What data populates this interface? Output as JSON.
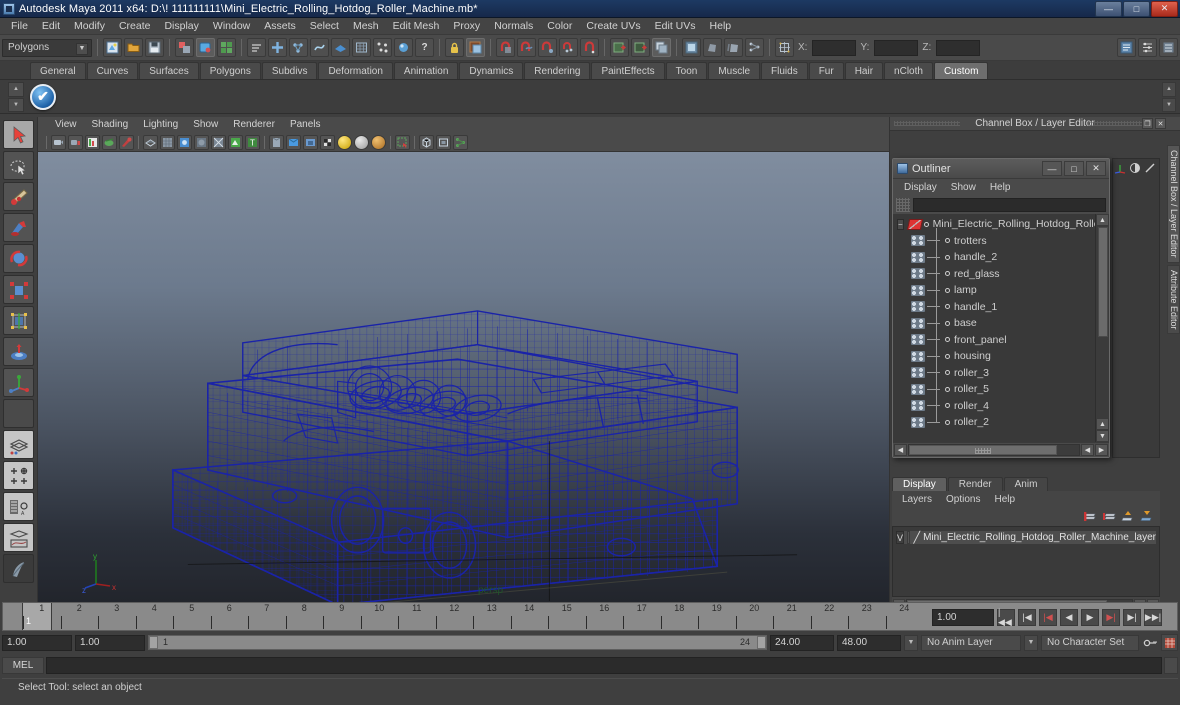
{
  "window": {
    "title": "Autodesk Maya 2011 x64: D:\\! 111111111\\Mini_Electric_Rolling_Hotdog_Roller_Machine.mb*",
    "minimize": "—",
    "maximize": "□",
    "close": "✕"
  },
  "menubar": {
    "items": [
      "File",
      "Edit",
      "Modify",
      "Create",
      "Display",
      "Window",
      "Assets",
      "Select",
      "Mesh",
      "Edit Mesh",
      "Proxy",
      "Normals",
      "Color",
      "Create UVs",
      "Edit UVs",
      "Help"
    ]
  },
  "statusbar": {
    "mode": "Polygons",
    "x_label": "X:",
    "y_label": "Y:",
    "z_label": "Z:",
    "x_value": "",
    "y_value": "",
    "z_value": ""
  },
  "shelf": {
    "tabs": [
      "General",
      "Curves",
      "Surfaces",
      "Polygons",
      "Subdivs",
      "Deformation",
      "Animation",
      "Dynamics",
      "Rendering",
      "PaintEffects",
      "Toon",
      "Muscle",
      "Fluids",
      "Fur",
      "Hair",
      "nCloth",
      "Custom"
    ],
    "active_tab": "Custom",
    "item_icon": "checkmark-icon"
  },
  "toolbox": {
    "tools": [
      {
        "name": "select-tool",
        "state": "active"
      },
      {
        "name": "lasso-select-tool",
        "state": "normal"
      },
      {
        "name": "paint-select-tool",
        "state": "normal"
      },
      {
        "name": "move-tool",
        "state": "normal"
      },
      {
        "name": "rotate-tool",
        "state": "normal"
      },
      {
        "name": "scale-tool",
        "state": "normal"
      },
      {
        "name": "universal-manipulator-tool",
        "state": "normal"
      },
      {
        "name": "soft-modification-tool",
        "state": "normal"
      },
      {
        "name": "last-tool-used",
        "state": "normal"
      },
      {
        "name": "empty-slot",
        "state": "empty"
      },
      {
        "name": "single-perspective-layout",
        "state": "light"
      },
      {
        "name": "four-view-layout",
        "state": "light"
      },
      {
        "name": "outliner-persp-layout",
        "state": "light"
      },
      {
        "name": "hypergraph-persp-layout",
        "state": "light"
      },
      {
        "name": "paint-effects-layout",
        "state": "dark"
      }
    ]
  },
  "viewport": {
    "menus": [
      "View",
      "Shading",
      "Lighting",
      "Show",
      "Renderer",
      "Panels"
    ],
    "camera_label": "persp",
    "axis": {
      "x": "x",
      "y": "y",
      "z": "z"
    },
    "wireframe_color": "#1a23a8",
    "background_top": "#7f8c9f",
    "background_bottom": "#23262d"
  },
  "channelbox_panel": {
    "title": "Channel Box / Layer Editor",
    "restore_icon": "restore-icon",
    "close_icon": "close-icon"
  },
  "outliner": {
    "title": "Outliner",
    "window_buttons": {
      "minimize": "—",
      "maximize": "□",
      "close": "✕"
    },
    "menus": [
      "Display",
      "Show",
      "Help"
    ],
    "search_value": "",
    "search_placeholder": "",
    "items": [
      {
        "label": "Mini_Electric_Rolling_Hotdog_Rolle",
        "type": "root",
        "expanded": true
      },
      {
        "label": "trotters",
        "type": "mesh"
      },
      {
        "label": "handle_2",
        "type": "mesh"
      },
      {
        "label": "red_glass",
        "type": "mesh"
      },
      {
        "label": "lamp",
        "type": "mesh"
      },
      {
        "label": "handle_1",
        "type": "mesh"
      },
      {
        "label": "base",
        "type": "mesh"
      },
      {
        "label": "front_panel",
        "type": "mesh"
      },
      {
        "label": "housing",
        "type": "mesh"
      },
      {
        "label": "roller_3",
        "type": "mesh"
      },
      {
        "label": "roller_5",
        "type": "mesh"
      },
      {
        "label": "roller_4",
        "type": "mesh"
      },
      {
        "label": "roller_2",
        "type": "mesh"
      }
    ]
  },
  "layer_editor": {
    "tabs": [
      "Display",
      "Render",
      "Anim"
    ],
    "active_tab": "Display",
    "menus": [
      "Layers",
      "Options",
      "Help"
    ],
    "toolbar_icons": [
      "new-layer-icon",
      "new-layer-from-selection-icon",
      "layer-up-icon",
      "layer-down-icon"
    ],
    "layers": [
      {
        "visibility": "V",
        "display_type": "",
        "name": "Mini_Electric_Rolling_Hotdog_Roller_Machine_layer"
      }
    ]
  },
  "right_tabs": [
    {
      "label": "Channel Box / Layer Editor",
      "active": true
    },
    {
      "label": "Attribute Editor",
      "active": false
    }
  ],
  "timeline": {
    "ticks": [
      "1",
      "2",
      "3",
      "4",
      "5",
      "6",
      "7",
      "8",
      "9",
      "10",
      "11",
      "12",
      "13",
      "14",
      "15",
      "16",
      "17",
      "18",
      "19",
      "20",
      "21",
      "22",
      "23",
      "24"
    ],
    "current_frame": "1",
    "start_field": "1.00",
    "end_field": "1.00",
    "range_start": "1",
    "range_end": "24",
    "anim_start": "24.00",
    "anim_end": "48.00",
    "current_time": "1.00",
    "anim_layer": "No Anim Layer",
    "character_set": "No Character Set",
    "playback_buttons": [
      "go-to-start",
      "step-back-keyframe",
      "step-back-frame",
      "play-backwards",
      "play-forwards",
      "step-forward-frame",
      "step-forward-keyframe",
      "go-to-end"
    ]
  },
  "command_line": {
    "language_label": "MEL",
    "command_value": ""
  },
  "help_line": {
    "text": "Select Tool: select an object"
  }
}
